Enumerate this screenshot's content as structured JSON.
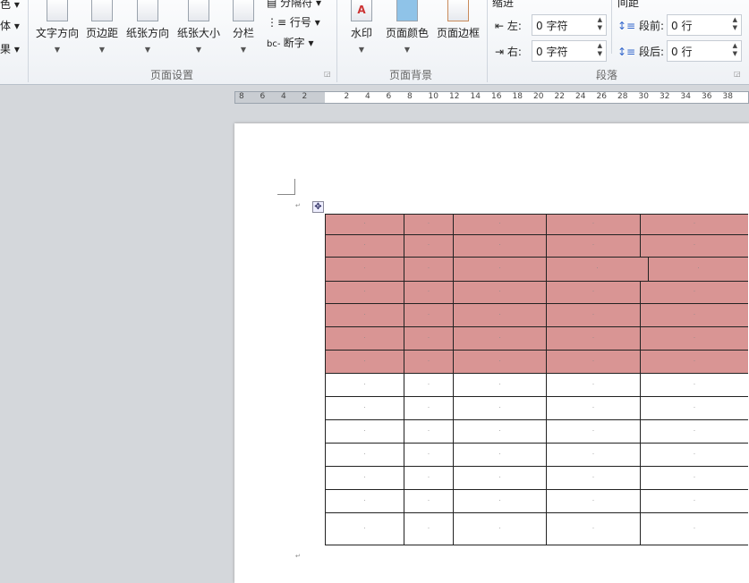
{
  "ribbon": {
    "left_partial": [
      "色 ▾",
      "体 ▾",
      "果 ▾"
    ],
    "page_setup": {
      "group_label": "页面设置",
      "text_direction": "文字方向",
      "margins": "页边距",
      "orientation": "纸张方向",
      "size": "纸张大小",
      "columns": "分栏",
      "breaks": "分隔符 ▾",
      "line_numbers": "行号 ▾",
      "hyphenation": "断字 ▾"
    },
    "page_background": {
      "group_label": "页面背景",
      "watermark": "水印",
      "page_color": "页面颜色",
      "page_borders": "页面边框"
    },
    "paragraph": {
      "group_label": "段落",
      "indent_label": "缩进",
      "spacing_label": "间距",
      "left_label": "左:",
      "left_value": "0 字符",
      "right_label": "右:",
      "right_value": "0 字符",
      "before_label": "段前:",
      "before_value": "0 行",
      "after_label": "段后:",
      "after_value": "0 行"
    }
  },
  "ruler": {
    "ticks": [
      "8",
      "6",
      "4",
      "2",
      "",
      "2",
      "4",
      "6",
      "8",
      "10",
      "12",
      "14",
      "16",
      "18",
      "20",
      "22",
      "24",
      "26",
      "28",
      "30",
      "32",
      "34",
      "36",
      "38"
    ]
  },
  "document": {
    "cell_mark": "·",
    "para_mark": "↵",
    "shading_color": "#d99594",
    "pink_rows": 7,
    "white_rows": 7
  }
}
